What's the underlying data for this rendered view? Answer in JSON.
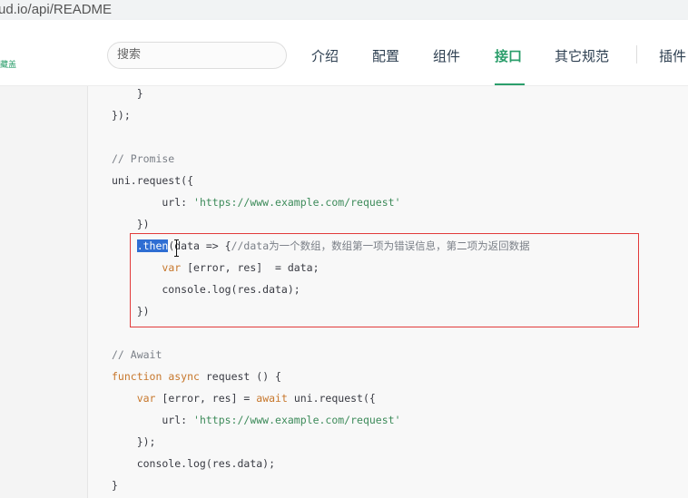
{
  "browser": {
    "url": "ud.io/api/README"
  },
  "header": {
    "logo_text": "藏盖",
    "search_placeholder": "搜索",
    "nav": [
      {
        "label": "介绍"
      },
      {
        "label": "配置"
      },
      {
        "label": "组件"
      },
      {
        "label": "接口"
      },
      {
        "label": "其它规范"
      },
      {
        "label": "插件"
      }
    ],
    "active_nav": "接口"
  },
  "code": {
    "line1": "    }",
    "line2": "});",
    "line3": "// Promise",
    "line4": "uni.request({",
    "line5_indent": "        url: ",
    "line5_string": "'https://www.example.com/request'",
    "line6": "    })",
    "line7_indent": "    ",
    "line7_selected": ".then",
    "line7_rest": "(data => {",
    "line7_comment": "//data为一个数组，数组第一项为错误信息，第二项为返回数据",
    "line8_indent": "        ",
    "line8_keyword": "var",
    "line8_rest": " [error, res]  = data;",
    "line9": "        console.log(res.data);",
    "line10": "    })",
    "line11": "// Await",
    "line12_kw1": "function",
    "line12_kw2": "async",
    "line12_rest": " request () {",
    "line13_indent": "    ",
    "line13_kw": "var",
    "line13_mid": " [error, res] = ",
    "line13_kw2": "await",
    "line13_rest": " uni.request({",
    "line14_indent": "        url: ",
    "line14_string": "'https://www.example.com/request'",
    "line15": "    });",
    "line16": "    console.log(res.data);",
    "line17": "}"
  },
  "colors": {
    "accent": "#2b9e6b",
    "highlight_border": "#e23a3a",
    "selection": "#2f6ed3"
  }
}
